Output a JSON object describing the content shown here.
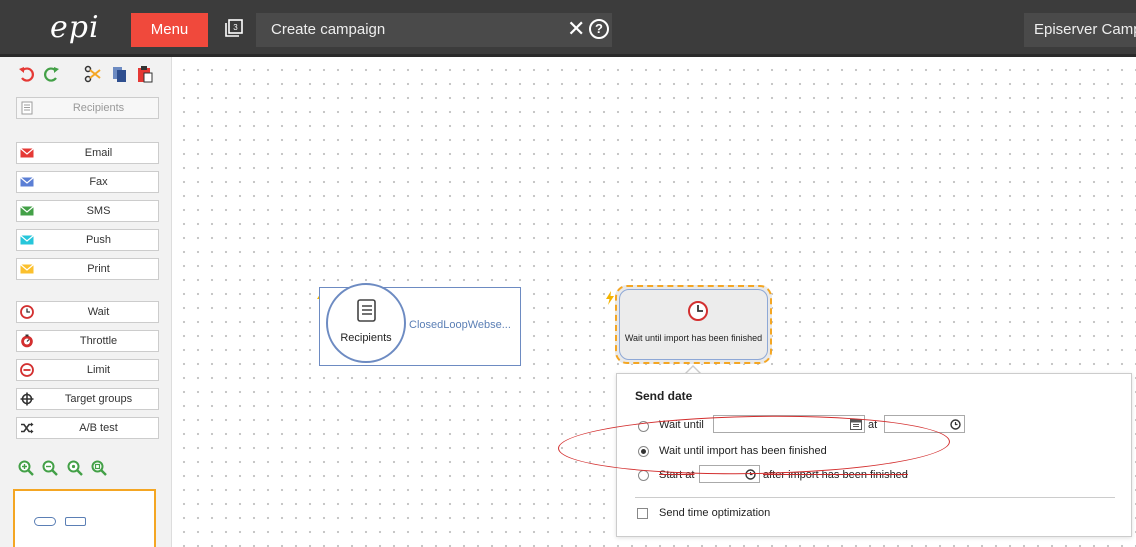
{
  "header": {
    "logo_text": "epi",
    "menu_label": "Menu",
    "title": "Create campaign",
    "close_glyph": "✕",
    "help_glyph": "?",
    "product_label": "Episerver Campaign"
  },
  "sidebar": {
    "toolbar_icons": [
      "undo-icon",
      "redo-icon",
      "cut-icon",
      "copy-icon",
      "paste-icon"
    ],
    "items": [
      {
        "label": "Recipients",
        "icon": "document-icon",
        "color": "#9e9e9e",
        "disabled": true
      },
      {
        "label": "Email",
        "icon": "email-icon",
        "color": "#e53935"
      },
      {
        "label": "Fax",
        "icon": "fax-icon",
        "color": "#5b7fd5"
      },
      {
        "label": "SMS",
        "icon": "sms-icon",
        "color": "#43a047"
      },
      {
        "label": "Push",
        "icon": "push-icon",
        "color": "#26c6da"
      },
      {
        "label": "Print",
        "icon": "print-icon",
        "color": "#fbc02d"
      },
      {
        "label": "Wait",
        "icon": "clock-icon",
        "color": "#d32f2f"
      },
      {
        "label": "Throttle",
        "icon": "throttle-icon",
        "color": "#d32f2f"
      },
      {
        "label": "Limit",
        "icon": "limit-icon",
        "color": "#d32f2f"
      },
      {
        "label": "Target groups",
        "icon": "crosshair-icon",
        "color": "#333333"
      },
      {
        "label": "A/B test",
        "icon": "shuffle-icon",
        "color": "#333333"
      }
    ],
    "zoom_icons": [
      "zoom-in-icon",
      "zoom-out-icon",
      "zoom-reset-icon",
      "zoom-fit-icon"
    ]
  },
  "canvas": {
    "recipients_node": {
      "label": "Recipients",
      "reference": "ClosedLoopWebse..."
    },
    "wait_node": {
      "label": "Wait until import has been finished"
    }
  },
  "popup": {
    "title": "Send date",
    "option_wait_until": "Wait until",
    "at_label": "at",
    "option_import_finished": "Wait until import has been finished",
    "option_start_at": "Start at",
    "after_import_label": "after import has been finished",
    "send_time_optimization": "Send time optimization"
  },
  "colors": {
    "accent": "#f0493c",
    "selection": "#f4a623",
    "node_border": "#6d8bc2",
    "annotation": "#d32f2f"
  }
}
